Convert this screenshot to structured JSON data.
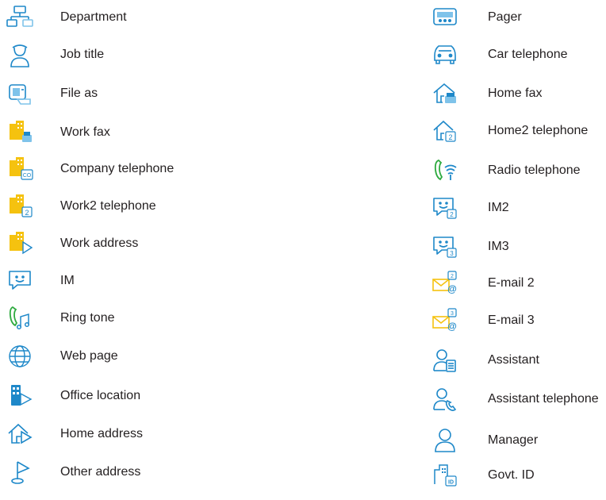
{
  "colors": {
    "blue": "#1e88c9",
    "light_blue": "#7fc3ea",
    "yellow": "#f5c20f",
    "green": "#2eaa3f"
  },
  "left": [
    {
      "label": "Department",
      "icon": "org-chart-icon"
    },
    {
      "label": "Job title",
      "icon": "person-hat-icon"
    },
    {
      "label": "File as",
      "icon": "contact-card-icon"
    },
    {
      "label": "Work fax",
      "icon": "building-fax-icon"
    },
    {
      "label": "Company telephone",
      "icon": "building-co-icon"
    },
    {
      "label": "Work2 telephone",
      "icon": "building-2-icon"
    },
    {
      "label": "Work address",
      "icon": "building-flag-icon"
    },
    {
      "label": "IM",
      "icon": "chat-smile-icon"
    },
    {
      "label": "Ring tone",
      "icon": "phone-music-icon"
    },
    {
      "label": "Web page",
      "icon": "globe-icon"
    },
    {
      "label": "Office location",
      "icon": "office-flag-icon"
    },
    {
      "label": "Home address",
      "icon": "home-flag-icon"
    },
    {
      "label": "Other address",
      "icon": "pin-flag-icon"
    }
  ],
  "right": [
    {
      "label": "Pager",
      "icon": "pager-icon"
    },
    {
      "label": "Car telephone",
      "icon": "car-icon"
    },
    {
      "label": "Home fax",
      "icon": "home-fax-icon"
    },
    {
      "label": "Home2 telephone",
      "icon": "home-2-icon"
    },
    {
      "label": "Radio telephone",
      "icon": "radio-phone-icon"
    },
    {
      "label": "IM2",
      "icon": "chat-2-icon",
      "badge": "2"
    },
    {
      "label": "IM3",
      "icon": "chat-3-icon",
      "badge": "3"
    },
    {
      "label": "E-mail 2",
      "icon": "email-2-icon",
      "badge": "2"
    },
    {
      "label": "E-mail 3",
      "icon": "email-3-icon",
      "badge": "3"
    },
    {
      "label": "Assistant",
      "icon": "assistant-icon"
    },
    {
      "label": "Assistant telephone",
      "icon": "assistant-phone-icon"
    },
    {
      "label": "Manager",
      "icon": "manager-icon"
    },
    {
      "label": "Govt. ID",
      "icon": "govt-id-icon",
      "badge": "ID"
    }
  ],
  "badges": {
    "co": "CO",
    "two": "2",
    "three": "3",
    "id": "ID"
  }
}
